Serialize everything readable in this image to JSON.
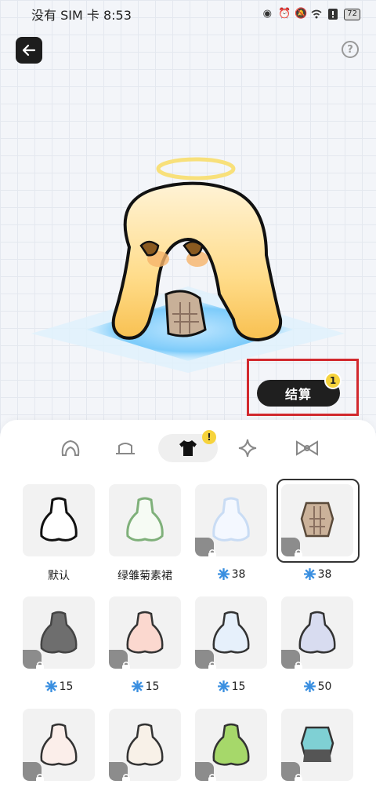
{
  "status_bar": {
    "carrier_time": "没有 SIM 卡 8:53",
    "battery": "72",
    "icons": [
      "eye-icon",
      "alarm-icon",
      "mute-icon",
      "wifi-icon",
      "alert-icon",
      "battery-icon"
    ]
  },
  "header": {
    "back_icon": "arrow-left-icon",
    "help_icon": "question-icon"
  },
  "checkout": {
    "label": "结算",
    "badge": "1"
  },
  "tabs": [
    {
      "name": "hair",
      "icon": "hair-icon",
      "active": false
    },
    {
      "name": "hat",
      "icon": "hat-icon",
      "active": false
    },
    {
      "name": "clothes",
      "icon": "shirt-icon",
      "active": true,
      "badge": "!"
    },
    {
      "name": "effects",
      "icon": "sparkle-icon",
      "active": false
    },
    {
      "name": "accessories",
      "icon": "bow-icon",
      "active": false
    }
  ],
  "items": [
    {
      "label": "默认",
      "price": null,
      "locked": false,
      "selected": false
    },
    {
      "label": "绿雏菊素裙",
      "price": null,
      "locked": false,
      "selected": false
    },
    {
      "label": "",
      "price": "38",
      "locked": true,
      "selected": false
    },
    {
      "label": "",
      "price": "38",
      "locked": true,
      "selected": true
    },
    {
      "label": "",
      "price": "15",
      "locked": true,
      "selected": false
    },
    {
      "label": "",
      "price": "15",
      "locked": true,
      "selected": false
    },
    {
      "label": "",
      "price": "15",
      "locked": true,
      "selected": false
    },
    {
      "label": "",
      "price": "50",
      "locked": true,
      "selected": false
    },
    {
      "label": "",
      "price": null,
      "locked": true,
      "selected": false
    },
    {
      "label": "",
      "price": null,
      "locked": true,
      "selected": false
    },
    {
      "label": "",
      "price": null,
      "locked": true,
      "selected": false
    },
    {
      "label": "",
      "price": null,
      "locked": true,
      "selected": false
    }
  ],
  "colors": {
    "accent_dark": "#1f1f1f",
    "badge": "#f6d33c",
    "highlight_box": "#d2292e",
    "gem": "#3a8fe0"
  }
}
